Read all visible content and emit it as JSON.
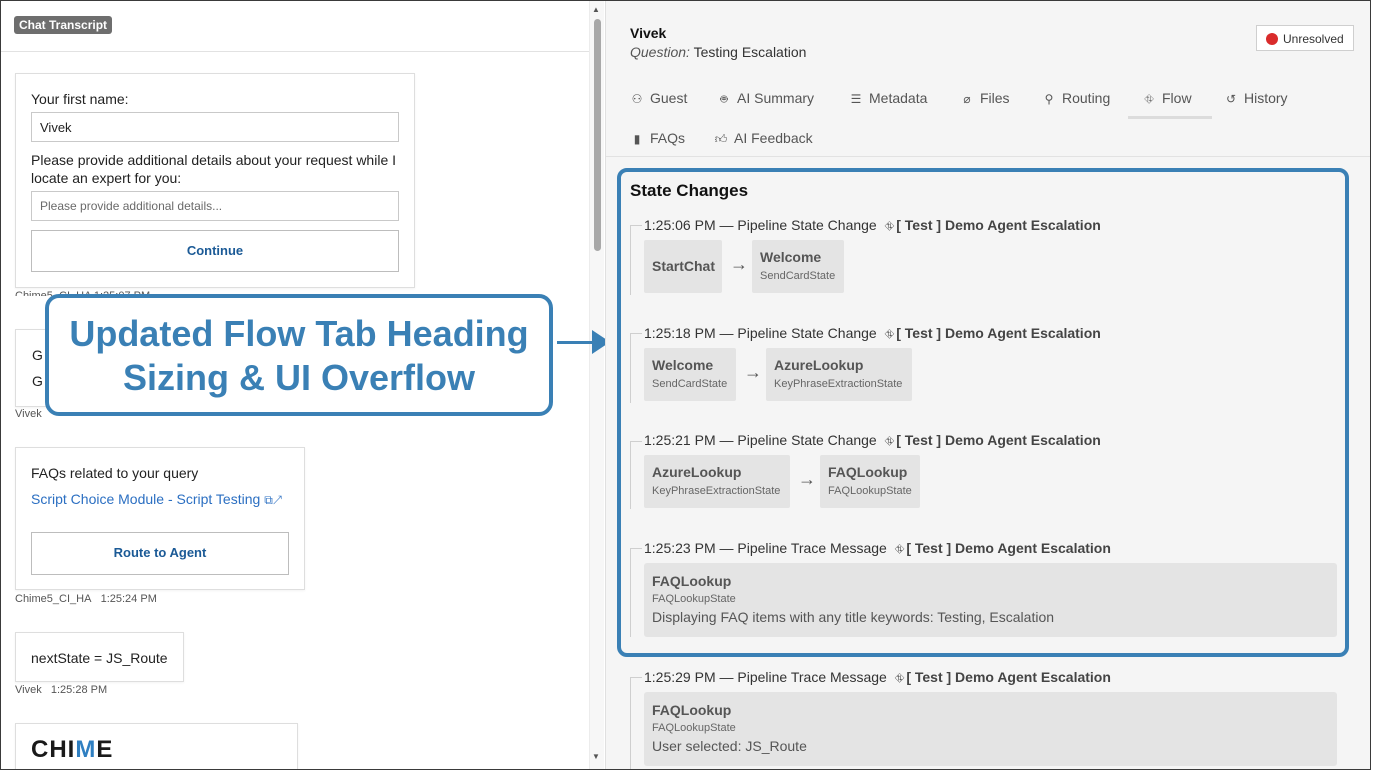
{
  "left": {
    "badge": "Chat Transcript",
    "form": {
      "first_name_label": "Your first name:",
      "first_name_value": "Vivek",
      "details_label_line1": "Please provide additional details about your request while I",
      "details_label_line2": "locate an expert for you:",
      "details_placeholder": "Please provide additional details...",
      "continue_label": "Continue",
      "meta": "Chime5_CI_HA   1:25:07 PM"
    },
    "hidden_card": {
      "line1": "G",
      "line2": "G",
      "meta": "Vivek"
    },
    "faq_card": {
      "title": "FAQs related to your query",
      "link": "Script Choice Module - Script Testing",
      "link_icon": "⧉↗",
      "route_label": "Route to Agent",
      "meta_sender": "Chime5_CI_HA",
      "meta_time": "1:25:24 PM"
    },
    "state_msg": {
      "text": "nextState = JS_Route",
      "meta_sender": "Vivek",
      "meta_time": "1:25:28 PM"
    },
    "logo": {
      "text_pre": "CHI",
      "text_accent": "M",
      "text_post": "E"
    }
  },
  "callout": {
    "line1": "Updated Flow Tab Heading",
    "line2": "Sizing & UI Overflow",
    "color": "#3a80b5"
  },
  "right": {
    "guest_name": "Vivek",
    "question_label": "Question:",
    "question_text": "Testing Escalation",
    "status": {
      "label": "Unresolved",
      "color": "#d92b2b"
    },
    "tabs": [
      {
        "label": "Guest",
        "icon": "person-icon",
        "glyph": "⚇"
      },
      {
        "label": "AI Summary",
        "icon": "robot-icon",
        "glyph": "🤖︎"
      },
      {
        "label": "Metadata",
        "icon": "list-icon",
        "glyph": "☰"
      },
      {
        "label": "Files",
        "icon": "paperclip-icon",
        "glyph": "⌀"
      },
      {
        "label": "Routing",
        "icon": "route-icon",
        "glyph": "⚲"
      },
      {
        "label": "Flow",
        "icon": "flow-icon",
        "glyph": "⛗"
      },
      {
        "label": "History",
        "icon": "history-icon",
        "glyph": "↺"
      },
      {
        "label": "FAQs",
        "icon": "book-icon",
        "glyph": "▮"
      },
      {
        "label": "AI Feedback",
        "icon": "thumbs-up-icon",
        "glyph": "👍︎"
      }
    ],
    "active_tab": "Flow",
    "section_title": "State Changes",
    "flow_glyph": "⛗",
    "events": [
      {
        "time": "1:25:06 PM",
        "kind": "Pipeline State Change",
        "flow": "[ Test ] Demo Agent Escalation",
        "from": {
          "name": "StartChat",
          "type": ""
        },
        "to": {
          "name": "Welcome",
          "type": "SendCardState"
        }
      },
      {
        "time": "1:25:18 PM",
        "kind": "Pipeline State Change",
        "flow": "[ Test ] Demo Agent Escalation",
        "from": {
          "name": "Welcome",
          "type": "SendCardState"
        },
        "to": {
          "name": "AzureLookup",
          "type": "KeyPhraseExtractionState"
        }
      },
      {
        "time": "1:25:21 PM",
        "kind": "Pipeline State Change",
        "flow": "[ Test ] Demo Agent Escalation",
        "from": {
          "name": "AzureLookup",
          "type": "KeyPhraseExtractionState"
        },
        "to": {
          "name": "FAQLookup",
          "type": "FAQLookupState"
        }
      },
      {
        "time": "1:25:23 PM",
        "kind": "Pipeline Trace Message",
        "flow": "[ Test ] Demo Agent Escalation",
        "state": {
          "name": "FAQLookup",
          "type": "FAQLookupState"
        },
        "message": "Displaying FAQ items with any title keywords: Testing, Escalation"
      },
      {
        "time": "1:25:29 PM",
        "kind": "Pipeline Trace Message",
        "flow": "[ Test ] Demo Agent Escalation",
        "state": {
          "name": "FAQLookup",
          "type": "FAQLookupState"
        },
        "message": "User selected: JS_Route"
      }
    ],
    "dash": "—",
    "arrow": "→"
  }
}
